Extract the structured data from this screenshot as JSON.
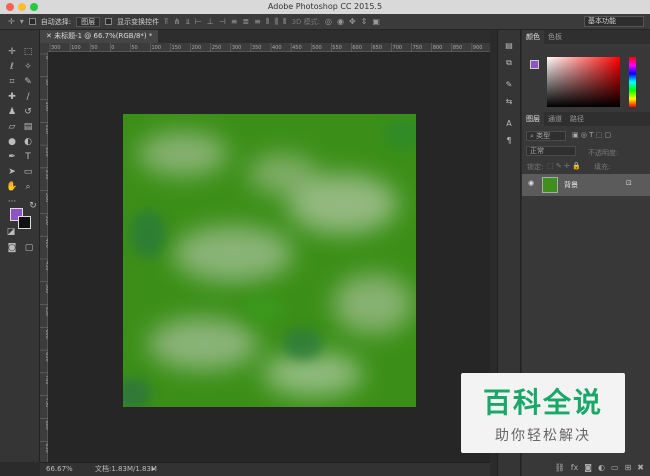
{
  "window": {
    "title": "Adobe Photoshop CC 2015.5"
  },
  "options_bar": {
    "move_tool_icon": "move-arrows-icon",
    "auto_select_label": "自动选择:",
    "auto_select_value": "图层",
    "transform_label": "显示变换控件",
    "mode_3d_label": "3D 模式:",
    "workspace_value": "基本功能"
  },
  "document": {
    "tab_title": "未标题-1 @ 66.7%(RGB/8*) *",
    "ruler_labels": [
      "300",
      "100",
      "50",
      "0",
      "50",
      "100",
      "150",
      "200",
      "250",
      "300",
      "350",
      "400",
      "450",
      "500",
      "550",
      "600",
      "650",
      "700",
      "750",
      "800",
      "850",
      "900"
    ],
    "vruler_labels": [
      "0",
      "50",
      "100",
      "150",
      "200",
      "250",
      "300",
      "350",
      "400",
      "450",
      "500",
      "550",
      "600",
      "650",
      "700",
      "750",
      "800",
      "850"
    ]
  },
  "status": {
    "zoom": "66.67%",
    "doc": "文档:1.83M/1.83M"
  },
  "panels": {
    "color_tabs": [
      "颜色",
      "色板"
    ],
    "layer_tabs": [
      "图层",
      "通道",
      "路径"
    ],
    "kind_filter": "类型",
    "blend_mode": "正常",
    "opacity_label": "不透明度:",
    "lock_label": "锁定:",
    "fill_label": "填充:",
    "layer_name": "背景"
  },
  "colors": {
    "foreground": "#8d55c3",
    "background": "#111111",
    "canvas_green": "#3b8f18"
  },
  "watermark": {
    "title": "百科全说",
    "subtitle": "助你轻松解决"
  }
}
